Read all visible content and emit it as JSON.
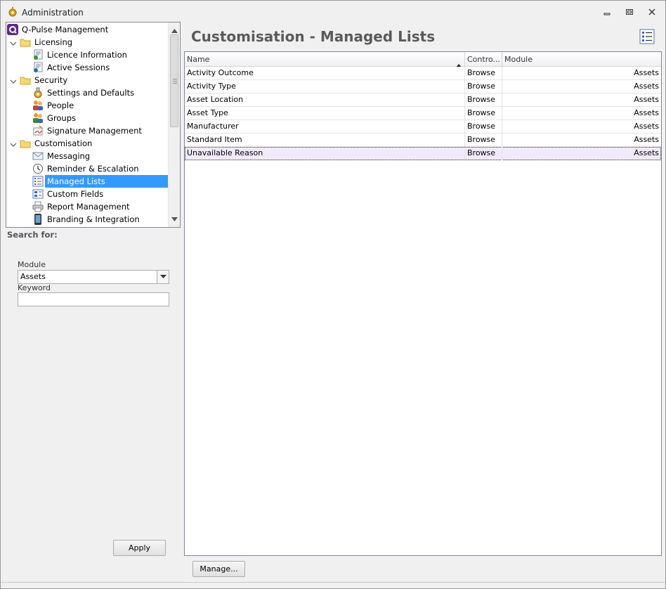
{
  "window": {
    "title": "Administration"
  },
  "tree": {
    "items": [
      {
        "label": "Q-Pulse Management"
      },
      {
        "label": "Licensing"
      },
      {
        "label": "Licence Information"
      },
      {
        "label": "Active Sessions"
      },
      {
        "label": "Security"
      },
      {
        "label": "Settings and Defaults"
      },
      {
        "label": "People"
      },
      {
        "label": "Groups"
      },
      {
        "label": "Signature Management"
      },
      {
        "label": "Customisation"
      },
      {
        "label": "Messaging"
      },
      {
        "label": "Reminder & Escalation"
      },
      {
        "label": "Managed Lists"
      },
      {
        "label": "Custom Fields"
      },
      {
        "label": "Report Management"
      },
      {
        "label": "Branding & Integration"
      }
    ]
  },
  "search": {
    "heading": "Search for:",
    "module_label": "Module",
    "module_value": "Assets",
    "keyword_label": "Keyword",
    "keyword_value": "",
    "apply_label": "Apply"
  },
  "main": {
    "title": "Customisation - Managed Lists",
    "columns": [
      "Name",
      "Contro...",
      "Module"
    ],
    "rows": [
      {
        "name": "Activity Outcome",
        "control": "Browse",
        "module": "Assets"
      },
      {
        "name": "Activity Type",
        "control": "Browse",
        "module": "Assets"
      },
      {
        "name": "Asset Location",
        "control": "Browse",
        "module": "Assets"
      },
      {
        "name": "Asset Type",
        "control": "Browse",
        "module": "Assets"
      },
      {
        "name": "Manufacturer",
        "control": "Browse",
        "module": "Assets"
      },
      {
        "name": "Standard Item",
        "control": "Browse",
        "module": "Assets"
      },
      {
        "name": "Unavailable Reason",
        "control": "Browse",
        "module": "Assets"
      }
    ],
    "manage_label": "Manage..."
  }
}
